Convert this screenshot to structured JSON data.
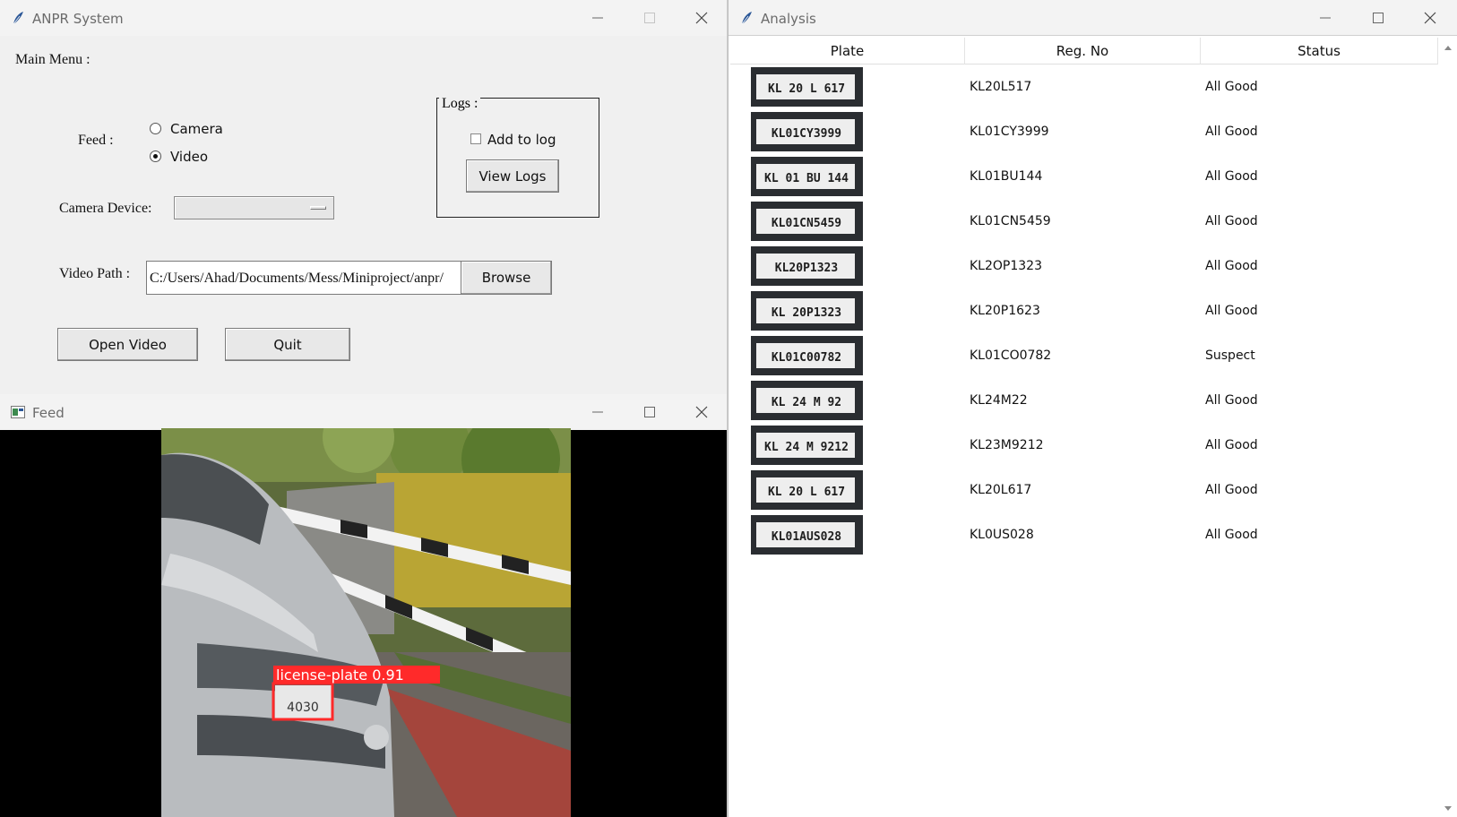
{
  "anpr_window": {
    "title": "ANPR System",
    "main_menu_label": "Main Menu :",
    "feed_label": "Feed :",
    "feed_options": [
      "Camera",
      "Video"
    ],
    "feed_selected": "Video",
    "camera_device_label": "Camera Device:",
    "camera_device_value": "",
    "video_path_label": "Video Path :",
    "video_path_value": "C:/Users/Ahad/Documents/Mess/Miniproject/anpr/",
    "browse_label": "Browse",
    "logs_label": "Logs :",
    "add_to_log_label": "Add to log",
    "add_to_log_checked": false,
    "view_logs_label": "View Logs",
    "open_video_label": "Open Video",
    "quit_label": "Quit"
  },
  "feed_window": {
    "title": "Feed",
    "detection_label": "license-plate 0.91",
    "plate_text": "4030"
  },
  "analysis_window": {
    "title": "Analysis",
    "columns": [
      "Plate",
      "Reg. No",
      "Status"
    ],
    "rows": [
      {
        "plate": "KL 20 L 617",
        "reg": "KL20L517",
        "status": "All Good"
      },
      {
        "plate": "KL01CY3999",
        "reg": "KL01CY3999",
        "status": "All Good"
      },
      {
        "plate": "KL 01 BU 144",
        "reg": "KL01BU144",
        "status": "All Good"
      },
      {
        "plate": "KL01CN5459",
        "reg": "KL01CN5459",
        "status": "All Good"
      },
      {
        "plate": "KL20P1323",
        "reg": "KL2OP1323",
        "status": "All Good"
      },
      {
        "plate": "KL 20P1323",
        "reg": "KL20P1623",
        "status": "All Good"
      },
      {
        "plate": "KL01C00782",
        "reg": "KL01CO0782",
        "status": "Suspect"
      },
      {
        "plate": "KL 24 M 92",
        "reg": "KL24M22",
        "status": "All Good"
      },
      {
        "plate": "KL 24 M 9212",
        "reg": "KL23M9212",
        "status": "All Good"
      },
      {
        "plate": "KL 20 L 617",
        "reg": "KL20L617",
        "status": "All Good"
      },
      {
        "plate": "KL01AUS028",
        "reg": "KL0US028",
        "status": "All Good"
      }
    ]
  },
  "icons": {
    "app_icon": "feather-icon",
    "minimize": "minimize-icon",
    "maximize": "maximize-icon",
    "close": "close-icon"
  },
  "colors": {
    "detection_box": "#ff2a2a",
    "window_bg": "#f0f0f0",
    "titlebar_bg": "#f3f3f3"
  }
}
